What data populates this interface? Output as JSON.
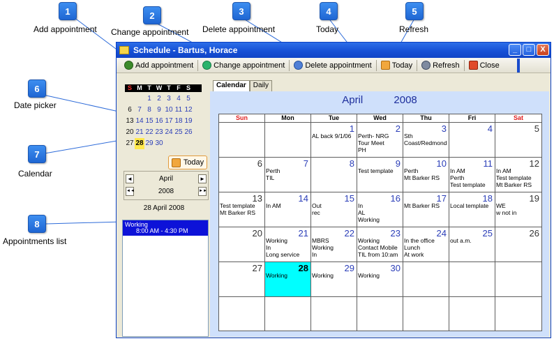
{
  "callouts": [
    {
      "num": "1",
      "label": "Add appointment"
    },
    {
      "num": "2",
      "label": "Change appointment"
    },
    {
      "num": "3",
      "label": "Delete appointment"
    },
    {
      "num": "4",
      "label": "Today"
    },
    {
      "num": "5",
      "label": "Refresh"
    },
    {
      "num": "6",
      "label": "Date picker"
    },
    {
      "num": "7",
      "label": "Calendar"
    },
    {
      "num": "8",
      "label": "Appointments list"
    }
  ],
  "window": {
    "title": "Schedule - Bartus, Horace",
    "buttons": {
      "minimize": "_",
      "maximize": "□",
      "close": "X"
    }
  },
  "toolbar": {
    "add": "Add appointment",
    "change": "Change appointment",
    "delete": "Delete appointment",
    "today": "Today",
    "refresh": "Refresh",
    "close": "Close"
  },
  "date_picker": {
    "weekdays": [
      "S",
      "M",
      "T",
      "W",
      "T",
      "F",
      "S"
    ],
    "days": [
      "",
      "",
      "1",
      "2",
      "3",
      "4",
      "5",
      "6",
      "7",
      "8",
      "9",
      "10",
      "11",
      "12",
      "13",
      "14",
      "15",
      "16",
      "17",
      "18",
      "19",
      "20",
      "21",
      "22",
      "23",
      "24",
      "25",
      "26",
      "27",
      "28",
      "29",
      "30",
      "",
      "",
      ""
    ],
    "today_index": 29,
    "today_button": "Today",
    "month": "April",
    "year": "2008",
    "arrow_prev": "◄",
    "arrow_next": "►",
    "arrow_prev_fast": "◄◄",
    "arrow_next_fast": "►►",
    "selected_date": "28 April 2008"
  },
  "appointments": [
    {
      "title": "Working",
      "time": "8:00 AM - 4:30 PM"
    }
  ],
  "tabs": {
    "calendar": "Calendar",
    "daily": "Daily"
  },
  "calendar": {
    "month": "April",
    "year": "2008",
    "weekdays": [
      "Sun",
      "Mon",
      "Tue",
      "Wed",
      "Thu",
      "Fri",
      "Sat"
    ],
    "cells": [
      {
        "day": "",
        "events": []
      },
      {
        "day": "",
        "events": []
      },
      {
        "day": "1",
        "events": [
          "AL back 9/1/06"
        ]
      },
      {
        "day": "2",
        "events": [
          "Perth- NRG",
          "Tour Meet",
          "PH"
        ]
      },
      {
        "day": "3",
        "events": [
          "Sth",
          "Coast/Redmond"
        ]
      },
      {
        "day": "4",
        "events": []
      },
      {
        "day": "5",
        "events": []
      },
      {
        "day": "6",
        "events": []
      },
      {
        "day": "7",
        "events": [
          "Perth",
          "TIL"
        ]
      },
      {
        "day": "8",
        "events": []
      },
      {
        "day": "9",
        "events": [
          "Test template"
        ]
      },
      {
        "day": "10",
        "events": [
          "Perth",
          "Mt Barker RS"
        ]
      },
      {
        "day": "11",
        "events": [
          "In AM",
          "Perth",
          "Test template"
        ]
      },
      {
        "day": "12",
        "events": [
          "In AM",
          "Test template",
          "Mt Barker RS"
        ]
      },
      {
        "day": "13",
        "events": [
          "Test template",
          "Mt Barker RS"
        ]
      },
      {
        "day": "14",
        "events": [
          "In AM"
        ]
      },
      {
        "day": "15",
        "events": [
          "Out",
          "rec"
        ]
      },
      {
        "day": "16",
        "events": [
          "In",
          "AL",
          "Working"
        ]
      },
      {
        "day": "17",
        "events": [
          "Mt Barker RS"
        ]
      },
      {
        "day": "18",
        "events": [
          "Local template"
        ]
      },
      {
        "day": "19",
        "events": [
          "WE",
          "w not in"
        ]
      },
      {
        "day": "20",
        "events": []
      },
      {
        "day": "21",
        "events": [
          "Working",
          "In",
          "Long service"
        ]
      },
      {
        "day": "22",
        "events": [
          "MBRS",
          "Working",
          "In"
        ]
      },
      {
        "day": "23",
        "events": [
          "Working",
          "Contact Mobile",
          "TIL from 10:am"
        ]
      },
      {
        "day": "24",
        "events": [
          "In the office",
          "Lunch",
          "At work"
        ]
      },
      {
        "day": "25",
        "events": [
          "out a.m."
        ]
      },
      {
        "day": "26",
        "events": []
      },
      {
        "day": "27",
        "events": []
      },
      {
        "day": "28",
        "events": [
          "Working"
        ]
      },
      {
        "day": "29",
        "events": [
          "Working"
        ]
      },
      {
        "day": "30",
        "events": [
          "Working"
        ]
      },
      {
        "day": "",
        "events": []
      },
      {
        "day": "",
        "events": []
      },
      {
        "day": "",
        "events": []
      },
      {
        "day": "",
        "events": []
      },
      {
        "day": "",
        "events": []
      },
      {
        "day": "",
        "events": []
      },
      {
        "day": "",
        "events": []
      },
      {
        "day": "",
        "events": []
      },
      {
        "day": "",
        "events": []
      },
      {
        "day": "",
        "events": []
      }
    ],
    "today_cell": 29
  },
  "colors": {
    "accent": "#1650d6",
    "today_highlight": "#00ffff",
    "appointment_bg": "#0d12d8"
  }
}
